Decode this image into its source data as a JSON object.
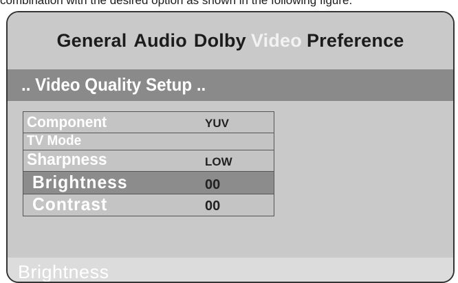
{
  "caption": "combination with the desired option as shown in the following figure.",
  "menu": {
    "items": [
      {
        "label": "General",
        "active": false
      },
      {
        "label": "Audio",
        "active": false
      },
      {
        "label": "Dolby",
        "active": false
      },
      {
        "label": "Video",
        "active": true
      },
      {
        "label": "Preference",
        "active": false
      }
    ]
  },
  "title": ".. Video Quality Setup ..",
  "settings": [
    {
      "label": "Component",
      "value": "YUV"
    },
    {
      "label": "TV Mode",
      "value": ""
    },
    {
      "label": "Sharpness",
      "value": "LOW"
    },
    {
      "label": "Brightness",
      "value": "00",
      "selected": true
    },
    {
      "label": "Contrast",
      "value": "00"
    }
  ],
  "status": "Brightness",
  "colors": {
    "panel_bg": "#c9c9c9",
    "title_bar": "#8a8a8a",
    "selected_row": "#8c8c8c",
    "active_tab_text": "#f2f2f2"
  }
}
